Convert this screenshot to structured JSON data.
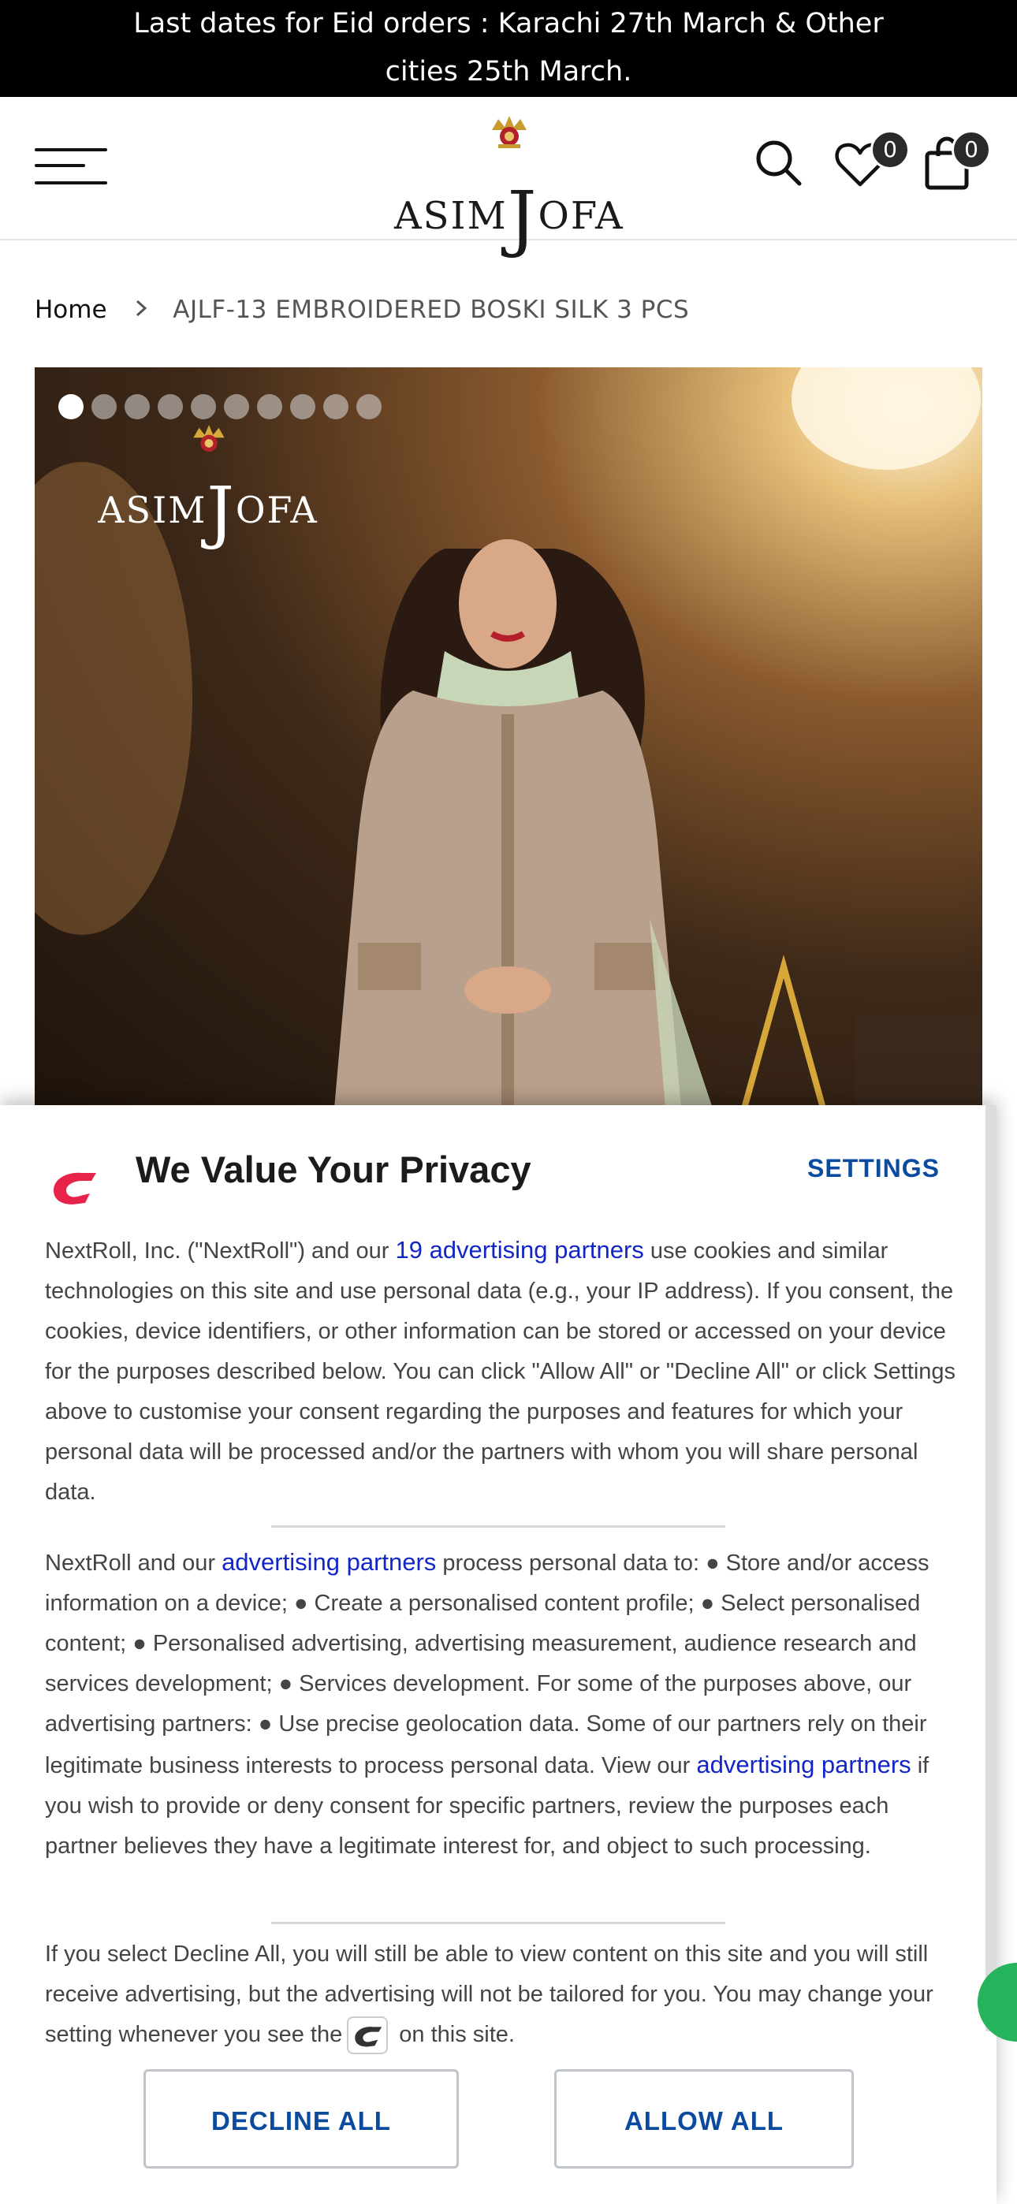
{
  "announcement": {
    "line1": "Last dates for Eid orders : Karachi 27th March & Other",
    "line2": "cities 25th March."
  },
  "header": {
    "logo_text_left": "ASIM",
    "logo_text_j": "J",
    "logo_text_right": "OFA",
    "wishlist_count": "0",
    "cart_count": "0",
    "icons": [
      "menu-icon",
      "search-icon",
      "heart-icon",
      "bag-icon"
    ]
  },
  "breadcrumb": {
    "home": "Home",
    "current": "AJLF-13 EMBROIDERED BOSKI SILK 3 PCS"
  },
  "gallery": {
    "slide_count": 10,
    "active_slide": 1,
    "image_logo_left": "ASIM",
    "image_logo_j": "J",
    "image_logo_right": "OFA"
  },
  "privacy": {
    "title": "We Value Your Privacy",
    "settings_label": "SETTINGS",
    "p1_before": "NextRoll, Inc. (\"NextRoll\") and our ",
    "p1_link": "19 advertising partners",
    "p1_after": " use cookies and similar technologies on this site and use personal data (e.g., your IP address). If you consent, the cookies, device identifiers, or other information can be stored or accessed on your device for the purposes described below. You can click \"Allow All\" or \"Decline All\" or click Settings above to customise your consent regarding the purposes and features for which your personal data will be processed and/or the partners with whom you will share personal data.",
    "p2_before": "NextRoll and our ",
    "p2_link": "advertising partners",
    "p2_middle": " process personal data to: ● Store and/or access information on a device; ● Create a personalised content profile; ● Select personalised content; ● Personalised advertising, advertising measurement, audience research and services development; ● Services development. For some of the purposes above, our advertising partners: ● Use precise geolocation data. Some of our partners rely on their legitimate business interests to process personal data. View our ",
    "p2_link2": "advertising partners",
    "p2_after": " if you wish to provide or deny consent for specific partners, review the purposes each partner believes they have a legitimate interest for, and object to such processing.",
    "p3_before": "If you select Decline All, you will still be able to view content on this site and you will still receive advertising, but the advertising will not be tailored for you. You may change your setting whenever you see the",
    "p3_after": "on this site.",
    "decline_label": "DECLINE ALL",
    "allow_label": "ALLOW ALL",
    "accent_color": "#0a4b9f",
    "link_color": "#1226c8",
    "brand_logo_color": "#e8234a"
  }
}
